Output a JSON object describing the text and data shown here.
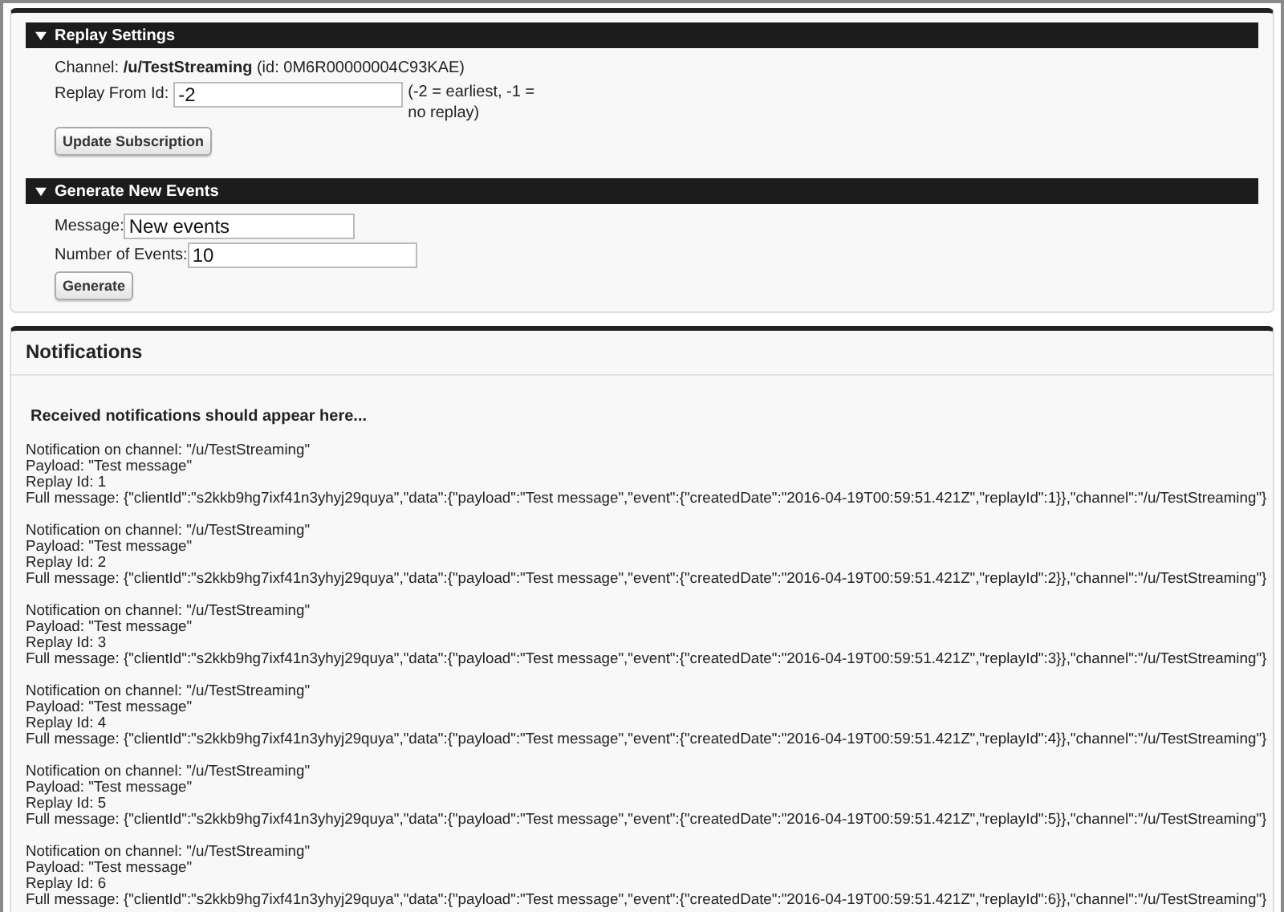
{
  "replay_settings": {
    "title": "Replay Settings",
    "expanded": true,
    "channel_line": "Channel:  **/u/TestStreaming** (id:  0M6R00000004C93KAE)",
    "replay_label": "Replay From Id:",
    "replay_value": "-2",
    "replay_hint": "(-2 = earliest, -1 = no replay)",
    "button": "Update Subscription"
  },
  "generate_events": {
    "title": "Generate New Events",
    "expanded": true,
    "message_label": "Message:",
    "message_value": "New events",
    "count_label": "Number of Events:",
    "count_value": "10",
    "button": "Generate"
  },
  "notifications": {
    "title": "Notifications",
    "intro": "Received notifications should appear here...",
    "items": [
      {
        "channel": "Notification on channel: \"/u/TestStreaming\"",
        "payload": "Payload: \"Test message\"",
        "replay_id": "Replay Id: 1",
        "full_message": "Full message: {\"clientId\":\"s2kkb9hg7ixf41n3yhyj29quya\",\"data\":{\"payload\":\"Test message\",\"event\":{\"createdDate\":\"2016-04-19T00:59:51.421Z\",\"replayId\":1}},\"channel\":\"/u/TestStreaming\"}"
      },
      {
        "channel": "Notification on channel: \"/u/TestStreaming\"",
        "payload": "Payload: \"Test message\"",
        "replay_id": "Replay Id: 2",
        "full_message": "Full message: {\"clientId\":\"s2kkb9hg7ixf41n3yhyj29quya\",\"data\":{\"payload\":\"Test message\",\"event\":{\"createdDate\":\"2016-04-19T00:59:51.421Z\",\"replayId\":2}},\"channel\":\"/u/TestStreaming\"}"
      },
      {
        "channel": "Notification on channel: \"/u/TestStreaming\"",
        "payload": "Payload: \"Test message\"",
        "replay_id": "Replay Id: 3",
        "full_message": "Full message: {\"clientId\":\"s2kkb9hg7ixf41n3yhyj29quya\",\"data\":{\"payload\":\"Test message\",\"event\":{\"createdDate\":\"2016-04-19T00:59:51.421Z\",\"replayId\":3}},\"channel\":\"/u/TestStreaming\"}"
      },
      {
        "channel": "Notification on channel: \"/u/TestStreaming\"",
        "payload": "Payload: \"Test message\"",
        "replay_id": "Replay Id: 4",
        "full_message": "Full message: {\"clientId\":\"s2kkb9hg7ixf41n3yhyj29quya\",\"data\":{\"payload\":\"Test message\",\"event\":{\"createdDate\":\"2016-04-19T00:59:51.421Z\",\"replayId\":4}},\"channel\":\"/u/TestStreaming\"}"
      },
      {
        "channel": "Notification on channel: \"/u/TestStreaming\"",
        "payload": "Payload: \"Test message\"",
        "replay_id": "Replay Id: 5",
        "full_message": "Full message: {\"clientId\":\"s2kkb9hg7ixf41n3yhyj29quya\",\"data\":{\"payload\":\"Test message\",\"event\":{\"createdDate\":\"2016-04-19T00:59:51.421Z\",\"replayId\":5}},\"channel\":\"/u/TestStreaming\"}"
      },
      {
        "channel": "Notification on channel: \"/u/TestStreaming\"",
        "payload": "Payload: \"Test message\"",
        "replay_id": "Replay Id: 6",
        "full_message": "Full message: {\"clientId\":\"s2kkb9hg7ixf41n3yhyj29quya\",\"data\":{\"payload\":\"Test message\",\"event\":{\"createdDate\":\"2016-04-19T00:59:51.421Z\",\"replayId\":6}},\"channel\":\"/u/TestStreaming\"}"
      }
    ]
  }
}
